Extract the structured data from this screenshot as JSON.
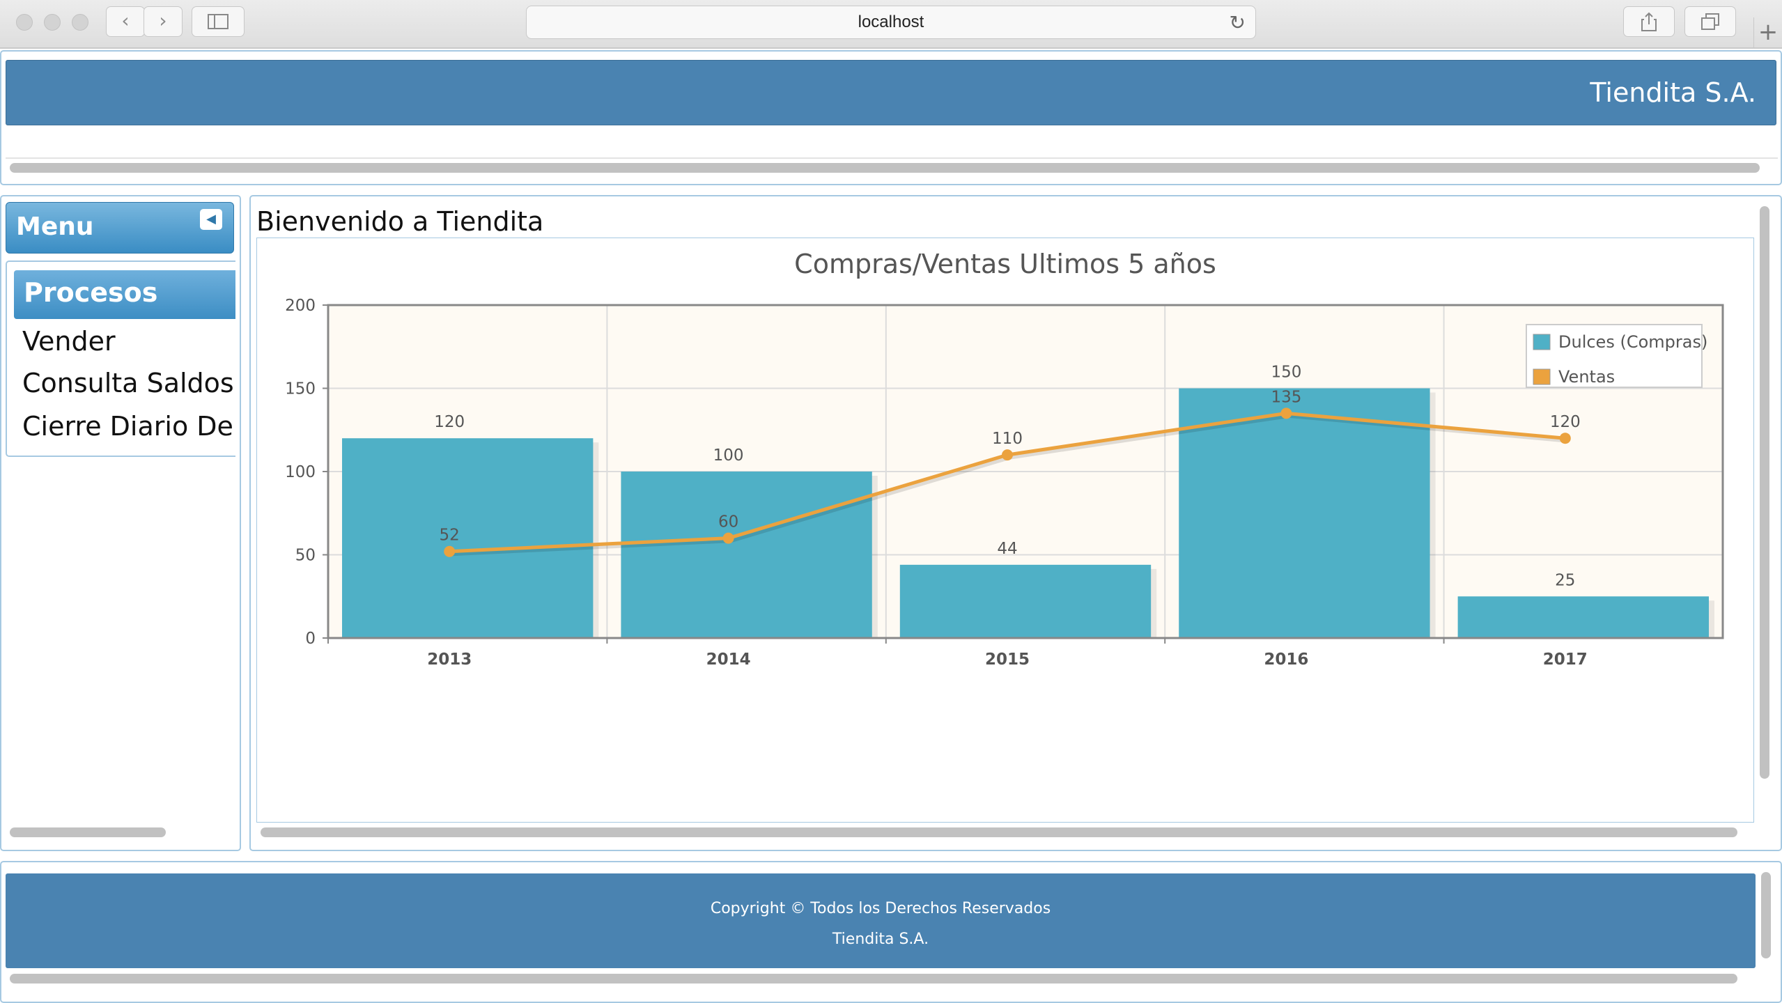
{
  "browser": {
    "url": "localhost"
  },
  "header": {
    "brand": "Tiendita S.A."
  },
  "menu": {
    "title": "Menu",
    "section": "Procesos",
    "items": [
      "Vender",
      "Consulta Saldos",
      "Cierre Diario De C"
    ]
  },
  "main": {
    "welcome": "Bienvenido a Tiendita"
  },
  "chart_data": {
    "type": "bar",
    "title": "Compras/Ventas Ultimos 5 años",
    "xlabel": "",
    "ylabel": "",
    "categories": [
      "2013",
      "2014",
      "2015",
      "2016",
      "2017"
    ],
    "ylim": [
      0,
      200
    ],
    "yticks": [
      0,
      50,
      100,
      150,
      200
    ],
    "grid": true,
    "legend_position": "top-right",
    "series": [
      {
        "name": "Dulces (Compras)",
        "type": "bar",
        "color": "#4fb0c6",
        "values": [
          120,
          100,
          44,
          150,
          25
        ]
      },
      {
        "name": "Ventas",
        "type": "line",
        "color": "#eba23e",
        "values": [
          52,
          60,
          110,
          135,
          120
        ]
      }
    ],
    "plot_background": "#fefaf3"
  },
  "footer": {
    "copyright": "Copyright © Todos los Derechos Reservados",
    "company": "Tiendita S.A."
  },
  "colors": {
    "header": "#4a83b1",
    "panel_border": "#a6c9e2",
    "accent": "#3a8dc4"
  }
}
